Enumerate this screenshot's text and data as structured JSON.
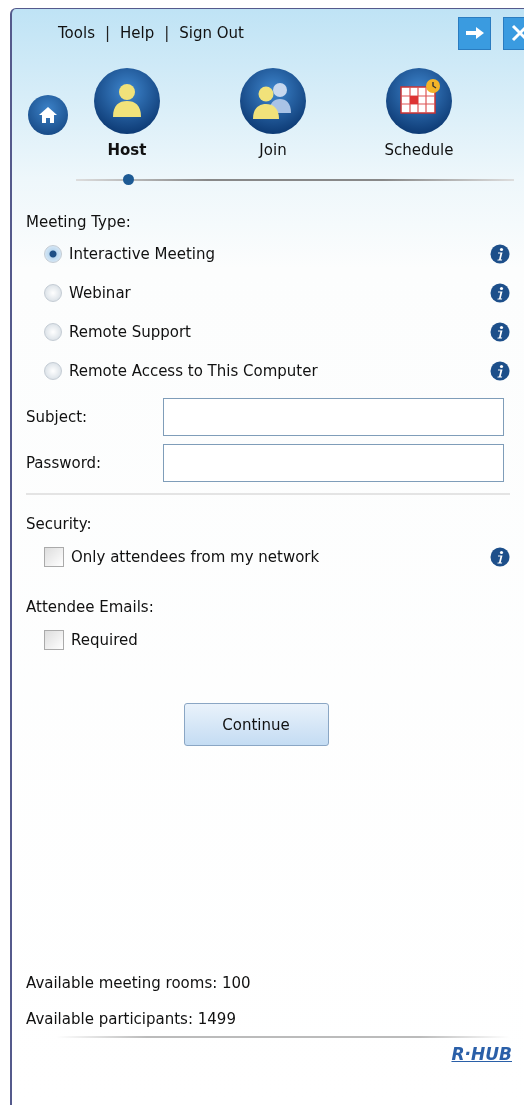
{
  "menu": [
    "Tools",
    "Help",
    "Sign Out"
  ],
  "menu_separator": "|",
  "nav_tabs": [
    {
      "label": "Host",
      "kind": "host",
      "selected": true
    },
    {
      "label": "Join",
      "kind": "join",
      "selected": false
    },
    {
      "label": "Schedule",
      "kind": "schedule",
      "selected": false
    }
  ],
  "meeting_type": {
    "label": "Meeting Type:",
    "options": [
      {
        "label": "Interactive Meeting",
        "selected": true
      },
      {
        "label": "Webinar",
        "selected": false
      },
      {
        "label": "Remote Support",
        "selected": false
      },
      {
        "label": "Remote Access to This Computer",
        "selected": false
      }
    ]
  },
  "fields": [
    {
      "label": "Subject:"
    },
    {
      "label": "Password:"
    }
  ],
  "security": {
    "label": "Security:",
    "option": {
      "label": "Only attendees from my network",
      "checked": false
    }
  },
  "attendee_emails": {
    "label": "Attendee Emails:",
    "option": {
      "label": "Required",
      "checked": false
    }
  },
  "continue_button": "Continue",
  "status": [
    "Available meeting rooms: 100",
    "Available participants: 1499"
  ],
  "logo": "R·HUB"
}
